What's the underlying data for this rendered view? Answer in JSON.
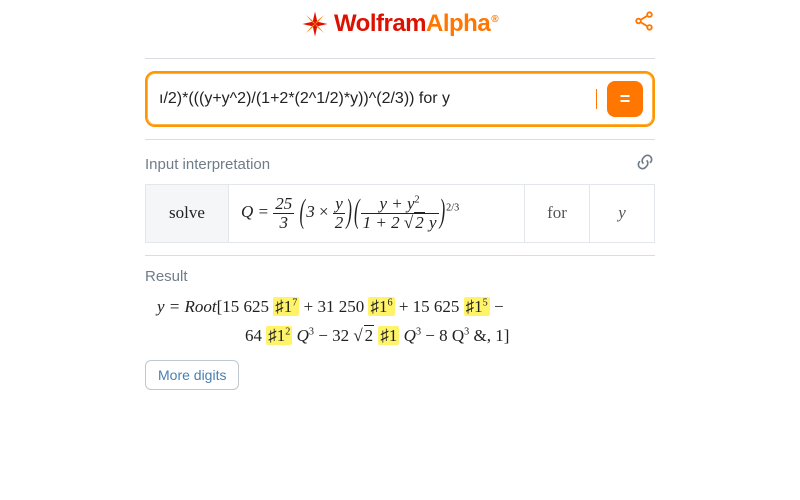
{
  "header": {
    "brand_part1": "Wolfram",
    "brand_part2": "Alpha",
    "brand_reg": "®"
  },
  "search": {
    "value": "ı/2)*(((y+y^2)/(1+2*(2^1/2)*y))^(2/3)) for y",
    "go_label": "="
  },
  "sections": {
    "interp_title": "Input interpretation",
    "result_title": "Result"
  },
  "interp": {
    "kw_solve": "solve",
    "kw_for": "for",
    "kw_var": "y",
    "eq_lhs": "Q",
    "coef_num": "25",
    "coef_den": "3",
    "inner_mult": "3",
    "inner_times": "×",
    "inner_frac_num": "y",
    "inner_frac_den": "2",
    "big_num": "y + y",
    "big_num_exp": "2",
    "big_den_pre": "1 + 2 ",
    "big_den_rad": "2",
    "big_den_post": " y",
    "outer_exp": "2/3"
  },
  "result": {
    "lead": "y = Root",
    "t1a": "15 625 ",
    "t1b": "♯1",
    "t1e": "7",
    "plus": " + ",
    "t2a": "31 250 ",
    "t2b": "♯1",
    "t2e": "6",
    "t3a": "15 625 ",
    "t3b": "♯1",
    "t3e": "5",
    "minus": " − ",
    "t4a": "64 ",
    "t4b": "♯1",
    "t4e": "2",
    "t4q": " Q",
    "t4qe": "3",
    "t5a": "32 ",
    "t5rad": "2",
    "t5sp": " ",
    "t5b": "♯1",
    "t5q": " Q",
    "t5qe": "3",
    "t6a": "8 Q",
    "t6qe": "3",
    "tail": " &, 1"
  },
  "buttons": {
    "more_digits": "More digits"
  }
}
